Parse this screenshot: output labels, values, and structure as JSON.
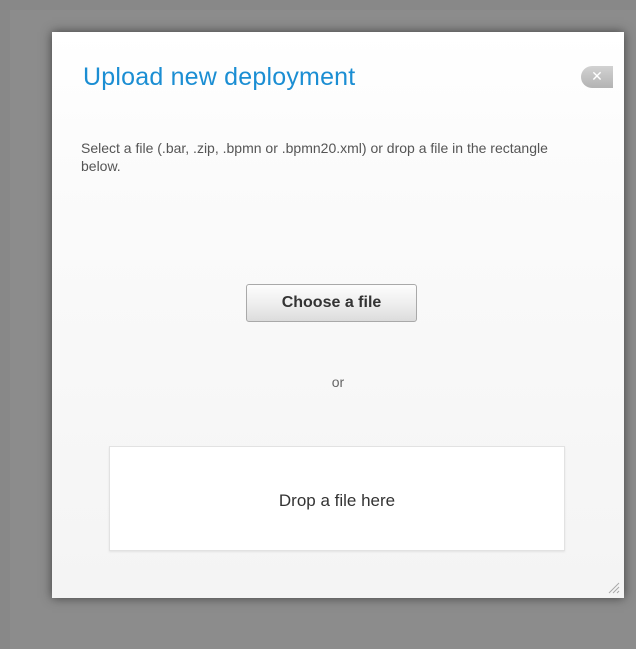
{
  "dialog": {
    "title": "Upload new deployment",
    "close_label": "✕",
    "description": "Select a file (.bar, .zip, .bpmn or .bpmn20.xml) or drop a file in the rectangle below.",
    "choose_button_label": "Choose a file",
    "separator_text": "or",
    "drop_zone_label": "Drop a file here"
  },
  "icons": {
    "close": "close-icon",
    "resize": "resize-grip-icon"
  },
  "colors": {
    "title": "#1b8ed3",
    "overlay": "#8c8c8c",
    "dialog_background": "#ffffff",
    "body_text": "#555555"
  }
}
